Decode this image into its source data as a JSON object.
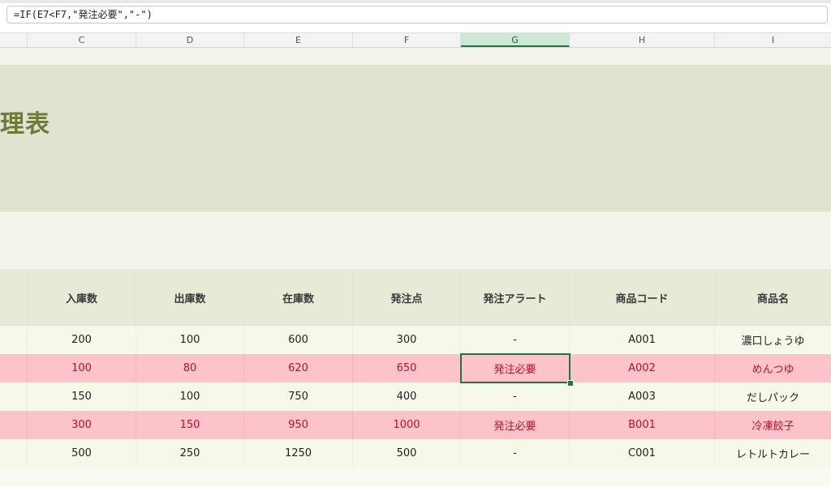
{
  "formula_bar": {
    "formula": "=IF(E7<F7,\"発注必要\",\"-\")"
  },
  "columns": [
    "C",
    "D",
    "E",
    "F",
    "G",
    "H",
    "I"
  ],
  "selected_column": "G",
  "sheet": {
    "title_fragment": "理表",
    "header": {
      "cells": [
        "",
        "入庫数",
        "出庫数",
        "在庫数",
        "発注点",
        "発注アラート",
        "商品コード",
        "商品名"
      ]
    },
    "rows": [
      {
        "alert": false,
        "cells": [
          "",
          "200",
          "100",
          "600",
          "300",
          "-",
          "A001",
          "濃口しょうゆ"
        ]
      },
      {
        "alert": true,
        "cells": [
          "",
          "100",
          "80",
          "620",
          "650",
          "発注必要",
          "A002",
          "めんつゆ"
        ]
      },
      {
        "alert": false,
        "cells": [
          "",
          "150",
          "100",
          "750",
          "400",
          "-",
          "A003",
          "だしパック"
        ]
      },
      {
        "alert": true,
        "cells": [
          "",
          "300",
          "150",
          "950",
          "1000",
          "発注必要",
          "B001",
          "冷凍餃子"
        ]
      },
      {
        "alert": false,
        "cells": [
          "",
          "500",
          "250",
          "1250",
          "500",
          "-",
          "C001",
          "レトルトカレー"
        ]
      }
    ]
  },
  "colors": {
    "title": "#6e7a35",
    "title_band": "#dfe4d0",
    "alert_row": "#fcc3ca",
    "alert_text": "#a8182c",
    "selection": "#217346"
  }
}
